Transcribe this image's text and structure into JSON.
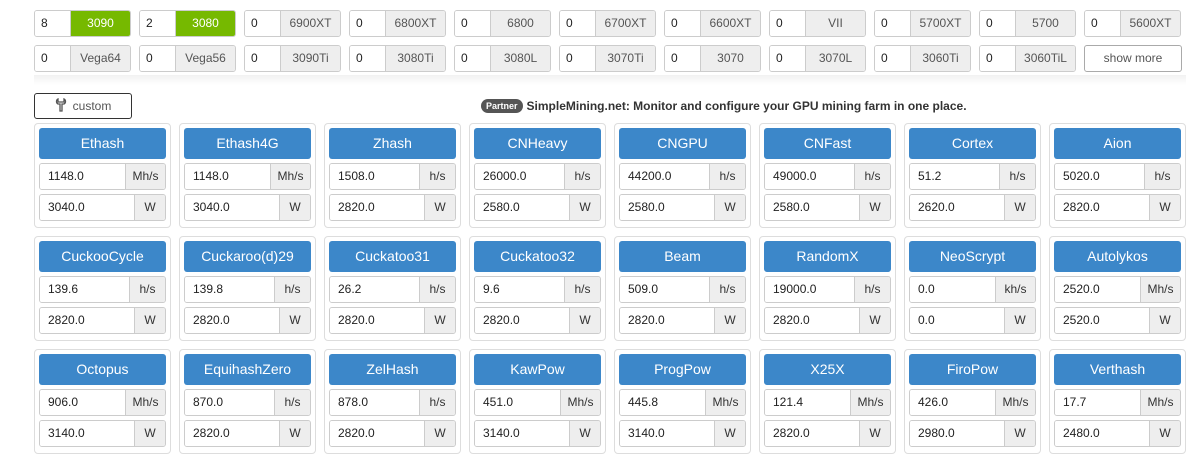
{
  "gpus_row1": [
    {
      "qty": "8",
      "name": "3090",
      "active": true
    },
    {
      "qty": "2",
      "name": "3080",
      "active": true
    },
    {
      "qty": "0",
      "name": "6900XT",
      "active": false
    },
    {
      "qty": "0",
      "name": "6800XT",
      "active": false
    },
    {
      "qty": "0",
      "name": "6800",
      "active": false
    },
    {
      "qty": "0",
      "name": "6700XT",
      "active": false
    },
    {
      "qty": "0",
      "name": "6600XT",
      "active": false
    },
    {
      "qty": "0",
      "name": "VII",
      "active": false
    },
    {
      "qty": "0",
      "name": "5700XT",
      "active": false
    },
    {
      "qty": "0",
      "name": "5700",
      "active": false
    },
    {
      "qty": "0",
      "name": "5600XT",
      "active": false
    }
  ],
  "gpus_row2": [
    {
      "qty": "0",
      "name": "Vega64",
      "active": false
    },
    {
      "qty": "0",
      "name": "Vega56",
      "active": false
    },
    {
      "qty": "0",
      "name": "3090Ti",
      "active": false
    },
    {
      "qty": "0",
      "name": "3080Ti",
      "active": false
    },
    {
      "qty": "0",
      "name": "3080L",
      "active": false
    },
    {
      "qty": "0",
      "name": "3070Ti",
      "active": false
    },
    {
      "qty": "0",
      "name": "3070",
      "active": false
    },
    {
      "qty": "0",
      "name": "3070L",
      "active": false
    },
    {
      "qty": "0",
      "name": "3060Ti",
      "active": false
    },
    {
      "qty": "0",
      "name": "3060TiL",
      "active": false
    }
  ],
  "show_more_label": "show more",
  "custom_label": "custom",
  "partner": {
    "badge": "Partner",
    "text": "SimpleMining.net: Monitor and configure your GPU mining farm in one place."
  },
  "colors": {
    "active_gpu": "#76b900",
    "algo_header": "#3c87c9"
  },
  "algorithms": [
    {
      "name": "Ethash",
      "hashrate": "1148.0",
      "hash_unit": "Mh/s",
      "power": "3040.0",
      "power_unit": "W"
    },
    {
      "name": "Ethash4G",
      "hashrate": "1148.0",
      "hash_unit": "Mh/s",
      "power": "3040.0",
      "power_unit": "W"
    },
    {
      "name": "Zhash",
      "hashrate": "1508.0",
      "hash_unit": "h/s",
      "power": "2820.0",
      "power_unit": "W"
    },
    {
      "name": "CNHeavy",
      "hashrate": "26000.0",
      "hash_unit": "h/s",
      "power": "2580.0",
      "power_unit": "W"
    },
    {
      "name": "CNGPU",
      "hashrate": "44200.0",
      "hash_unit": "h/s",
      "power": "2580.0",
      "power_unit": "W"
    },
    {
      "name": "CNFast",
      "hashrate": "49000.0",
      "hash_unit": "h/s",
      "power": "2580.0",
      "power_unit": "W"
    },
    {
      "name": "Cortex",
      "hashrate": "51.2",
      "hash_unit": "h/s",
      "power": "2620.0",
      "power_unit": "W"
    },
    {
      "name": "Aion",
      "hashrate": "5020.0",
      "hash_unit": "h/s",
      "power": "2820.0",
      "power_unit": "W"
    },
    {
      "name": "CuckooCycle",
      "hashrate": "139.6",
      "hash_unit": "h/s",
      "power": "2820.0",
      "power_unit": "W"
    },
    {
      "name": "Cuckaroo(d)29",
      "hashrate": "139.8",
      "hash_unit": "h/s",
      "power": "2820.0",
      "power_unit": "W"
    },
    {
      "name": "Cuckatoo31",
      "hashrate": "26.2",
      "hash_unit": "h/s",
      "power": "2820.0",
      "power_unit": "W"
    },
    {
      "name": "Cuckatoo32",
      "hashrate": "9.6",
      "hash_unit": "h/s",
      "power": "2820.0",
      "power_unit": "W"
    },
    {
      "name": "Beam",
      "hashrate": "509.0",
      "hash_unit": "h/s",
      "power": "2820.0",
      "power_unit": "W"
    },
    {
      "name": "RandomX",
      "hashrate": "19000.0",
      "hash_unit": "h/s",
      "power": "2820.0",
      "power_unit": "W"
    },
    {
      "name": "NeoScrypt",
      "hashrate": "0.0",
      "hash_unit": "kh/s",
      "power": "0.0",
      "power_unit": "W"
    },
    {
      "name": "Autolykos",
      "hashrate": "2520.0",
      "hash_unit": "Mh/s",
      "power": "2520.0",
      "power_unit": "W"
    },
    {
      "name": "Octopus",
      "hashrate": "906.0",
      "hash_unit": "Mh/s",
      "power": "3140.0",
      "power_unit": "W"
    },
    {
      "name": "EquihashZero",
      "hashrate": "870.0",
      "hash_unit": "h/s",
      "power": "2820.0",
      "power_unit": "W"
    },
    {
      "name": "ZelHash",
      "hashrate": "878.0",
      "hash_unit": "h/s",
      "power": "2820.0",
      "power_unit": "W"
    },
    {
      "name": "KawPow",
      "hashrate": "451.0",
      "hash_unit": "Mh/s",
      "power": "3140.0",
      "power_unit": "W"
    },
    {
      "name": "ProgPow",
      "hashrate": "445.8",
      "hash_unit": "Mh/s",
      "power": "3140.0",
      "power_unit": "W"
    },
    {
      "name": "X25X",
      "hashrate": "121.4",
      "hash_unit": "Mh/s",
      "power": "2820.0",
      "power_unit": "W"
    },
    {
      "name": "FiroPow",
      "hashrate": "426.0",
      "hash_unit": "Mh/s",
      "power": "2980.0",
      "power_unit": "W"
    },
    {
      "name": "Verthash",
      "hashrate": "17.7",
      "hash_unit": "Mh/s",
      "power": "2480.0",
      "power_unit": "W"
    }
  ]
}
